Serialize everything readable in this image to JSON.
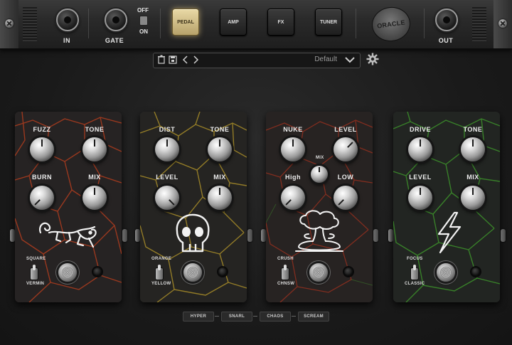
{
  "top": {
    "in_label": "IN",
    "gate_label": "GATE",
    "gate_off": "OFF",
    "gate_on": "ON",
    "out_label": "OUT",
    "logo": "ORACLE",
    "modes": [
      "PEDAL",
      "AMP",
      "FX",
      "TUNER"
    ],
    "active_mode": "PEDAL"
  },
  "preset": {
    "name": "Default",
    "icons": [
      "trash-icon",
      "save-icon",
      "prev-icon",
      "next-icon"
    ]
  },
  "pedals": [
    {
      "knobs": [
        "FUZZ",
        "TONE",
        "BURN",
        "MIX"
      ],
      "switch_top": "SQUARE",
      "switch_bottom": "VERMIN",
      "accent": "#c2401e",
      "icon": "lizard-icon"
    },
    {
      "knobs": [
        "DIST",
        "TONE",
        "LEVEL",
        "MIX"
      ],
      "switch_top": "ORANGE",
      "switch_bottom": "YELLOW",
      "accent": "#b89a2a",
      "icon": "skull-icon"
    },
    {
      "knobs": [
        "NUKE",
        "LEVEL",
        "High",
        "LOW"
      ],
      "mini_knob": "MIX",
      "switch_top": "CRUSH",
      "switch_bottom": "CHNSW",
      "accent": "#a8321e",
      "icon": "mushroom-cloud-icon"
    },
    {
      "knobs": [
        "DRIVE",
        "TONE",
        "LEVEL",
        "MIX"
      ],
      "switch_top": "FOCUS",
      "switch_bottom": "CLASSIC",
      "accent": "#3f9a2c",
      "icon": "lightning-icon"
    }
  ],
  "chain": [
    "HYPER",
    "SNARL",
    "CHAOS",
    "SCREAM"
  ]
}
